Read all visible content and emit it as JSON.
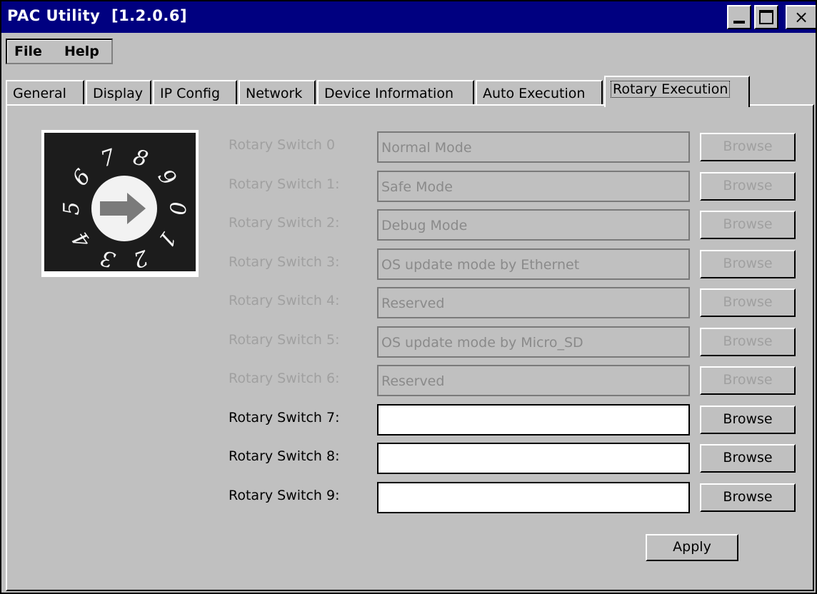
{
  "window": {
    "title": "PAC Utility  [1.2.0.6]",
    "minimize_label": "_",
    "close_label": "×"
  },
  "menu": {
    "file": "File",
    "help": "Help"
  },
  "tabs": [
    {
      "label": "General"
    },
    {
      "label": "Display"
    },
    {
      "label": "IP Config"
    },
    {
      "label": "Network"
    },
    {
      "label": "Device Information"
    },
    {
      "label": "Auto Execution"
    },
    {
      "label": "Rotary Execution",
      "active": true
    }
  ],
  "dial": {
    "numbers": [
      "0",
      "1",
      "2",
      "3",
      "4",
      "5",
      "6",
      "7",
      "8",
      "9"
    ],
    "position": "0",
    "icon": "rotary-switch-icon"
  },
  "rows": [
    {
      "label": "Rotary Switch 0",
      "value": "Normal Mode",
      "enabled": false
    },
    {
      "label": "Rotary Switch 1:",
      "value": "Safe Mode",
      "enabled": false
    },
    {
      "label": "Rotary Switch 2:",
      "value": "Debug Mode",
      "enabled": false
    },
    {
      "label": "Rotary Switch 3:",
      "value": "OS update mode by Ethernet",
      "enabled": false
    },
    {
      "label": "Rotary Switch 4:",
      "value": "Reserved",
      "enabled": false
    },
    {
      "label": "Rotary Switch 5:",
      "value": "OS update mode by Micro_SD",
      "enabled": false
    },
    {
      "label": "Rotary Switch 6:",
      "value": "Reserved",
      "enabled": false
    },
    {
      "label": "Rotary Switch 7:",
      "value": "",
      "enabled": true
    },
    {
      "label": "Rotary Switch 8:",
      "value": "",
      "enabled": true
    },
    {
      "label": "Rotary Switch 9:",
      "value": "",
      "enabled": true
    }
  ],
  "browse_label": "Browse",
  "apply_label": "Apply",
  "colors": {
    "titlebar": "#000080",
    "face": "#c0c0c0",
    "disabled_text": "#a0a0a0"
  }
}
